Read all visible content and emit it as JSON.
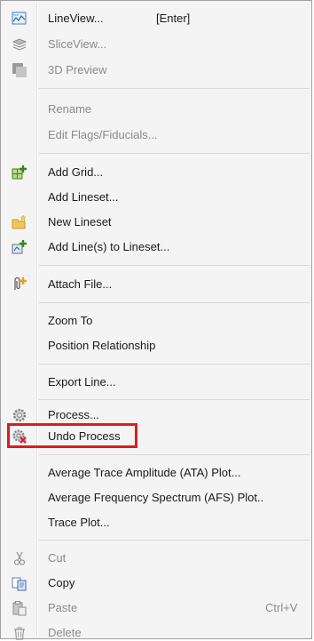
{
  "menu": {
    "items": [
      {
        "label": "LineView...",
        "shortcut": "[Enter]",
        "icon": "lineview-icon",
        "enabled": true
      },
      {
        "label": "SliceView...",
        "icon": "sliceview-icon",
        "enabled": false
      },
      {
        "label": "3D Preview",
        "icon": "3d-preview-icon",
        "enabled": false
      },
      {
        "label": "Rename",
        "enabled": false
      },
      {
        "label": "Edit Flags/Fiducials...",
        "enabled": false
      },
      {
        "label": "Add Grid...",
        "icon": "add-grid-icon",
        "enabled": true
      },
      {
        "label": "Add Lineset...",
        "enabled": true
      },
      {
        "label": "New Lineset",
        "icon": "new-lineset-folder-icon",
        "enabled": true
      },
      {
        "label": "Add Line(s) to Lineset...",
        "icon": "add-lines-icon",
        "enabled": true
      },
      {
        "label": "Attach File...",
        "icon": "attach-file-icon",
        "enabled": true
      },
      {
        "label": "Zoom To",
        "enabled": true
      },
      {
        "label": "Position Relationship",
        "enabled": true
      },
      {
        "label": "Export Line...",
        "enabled": true
      },
      {
        "label": "Process...",
        "icon": "gear-icon",
        "enabled": true
      },
      {
        "label": "Undo Process",
        "icon": "undo-process-icon",
        "enabled": true
      },
      {
        "label": "Average Trace Amplitude (ATA) Plot...",
        "enabled": true
      },
      {
        "label": "Average Frequency Spectrum (AFS) Plot..",
        "enabled": true
      },
      {
        "label": "Trace Plot...",
        "enabled": true
      },
      {
        "label": "Cut",
        "icon": "scissors-icon",
        "enabled": false
      },
      {
        "label": "Copy",
        "icon": "copy-icon",
        "enabled": true
      },
      {
        "label": "Paste",
        "shortcut": "Ctrl+V",
        "icon": "paste-icon",
        "enabled": false
      },
      {
        "label": "Delete",
        "icon": "trash-icon",
        "enabled": false
      }
    ]
  },
  "colors": {
    "menu_bg": "#f4f4f4",
    "highlight_border": "#e01b1b",
    "disabled_text": "#8a8a8a"
  }
}
